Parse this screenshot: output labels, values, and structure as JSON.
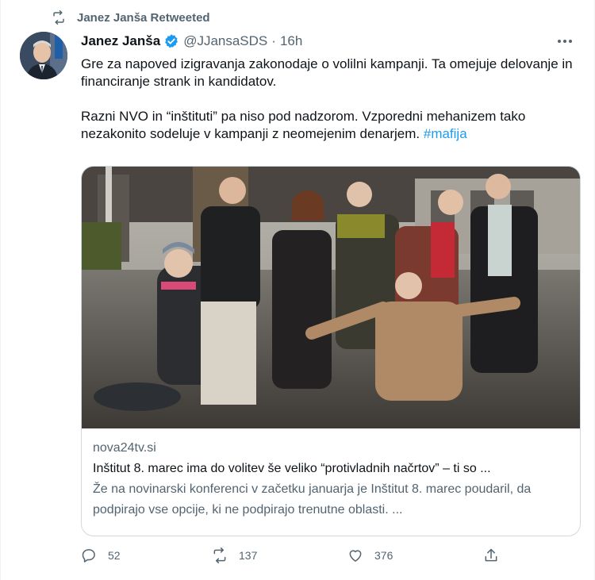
{
  "retweet_banner": {
    "text": "Janez Janša Retweeted",
    "icon": "retweet-icon"
  },
  "author": {
    "name": "Janez Janša",
    "handle": "@JJansaSDS",
    "separator": "·",
    "time": "16h",
    "verified": true,
    "verified_color": "#1d9bf0"
  },
  "tweet": {
    "paragraph1": "Gre za napoved izigravanja zakonodaje o volilni kampanji. Ta omejuje delovanje in financiranje strank in kandidatov.",
    "paragraph2": "Razni NVO in “inštituti” pa niso pod nadzorom. Vzporedni mehanizem tako nezakonito sodeluje v kampanji z neomejenim denarjem. ",
    "hashtag": "#mafija"
  },
  "card": {
    "domain": "nova24tv.si",
    "title": "Inštitut 8. marec ima do volitev še veliko “protivladnih načrtov” – ti so ...",
    "description": "Že na novinarski konferenci v začetku januarja je Inštitut 8. marec poudaril, da podpirajo vse opcije, ki ne podpirajo trenutne oblasti. ..."
  },
  "actions": {
    "replies": "52",
    "retweets": "137",
    "likes": "376"
  },
  "colors": {
    "accent": "#1d9bf0",
    "muted": "#536471",
    "text": "#0f1419",
    "border": "#cfd9de"
  }
}
